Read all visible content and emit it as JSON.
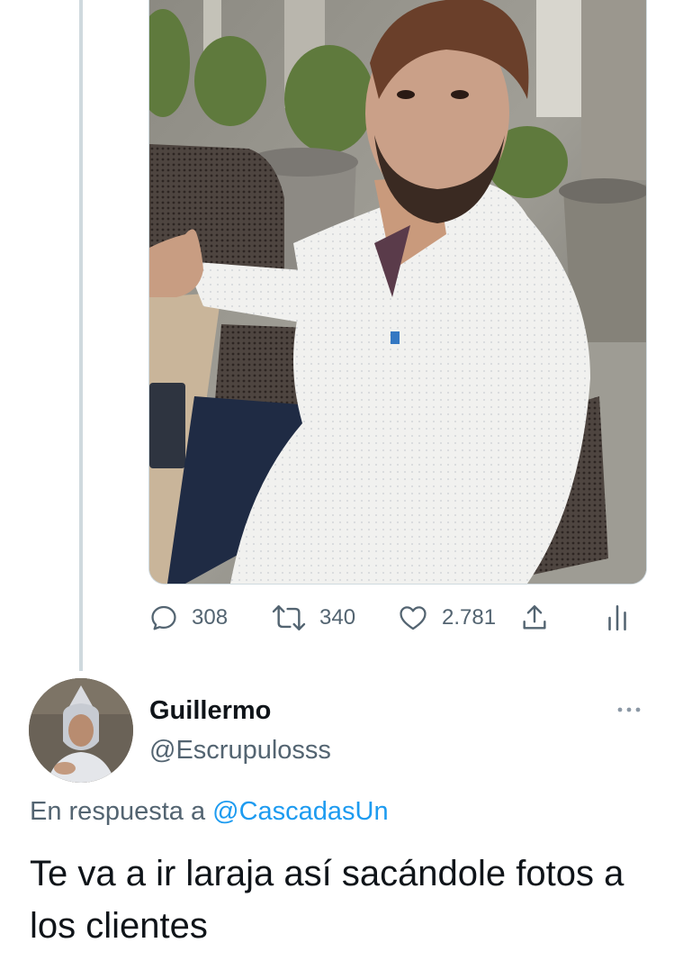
{
  "tweet": {
    "media_alt": "Foto de un hombre con camisa blanca haciendo un pulgar arriba sentado en una terraza",
    "stats": {
      "replies": "308",
      "retweets": "340",
      "likes": "2.781"
    },
    "icons": [
      "reply-icon",
      "retweet-icon",
      "like-icon",
      "share-icon",
      "analytics-icon"
    ]
  },
  "reply": {
    "display_name": "Guillermo",
    "handle": "@Escrupulosss",
    "in_reply_prefix": "En respuesta a",
    "in_reply_to": "@CascadasUn",
    "text": "Te va a ir laraja así sacándole fotos a los clientes",
    "icons": [
      "avatar",
      "more-options-icon"
    ]
  },
  "colors": {
    "primary_text": "#0f1419",
    "secondary_text": "#536471",
    "link": "#1d9bf0",
    "thread_line": "#cfd9de"
  }
}
